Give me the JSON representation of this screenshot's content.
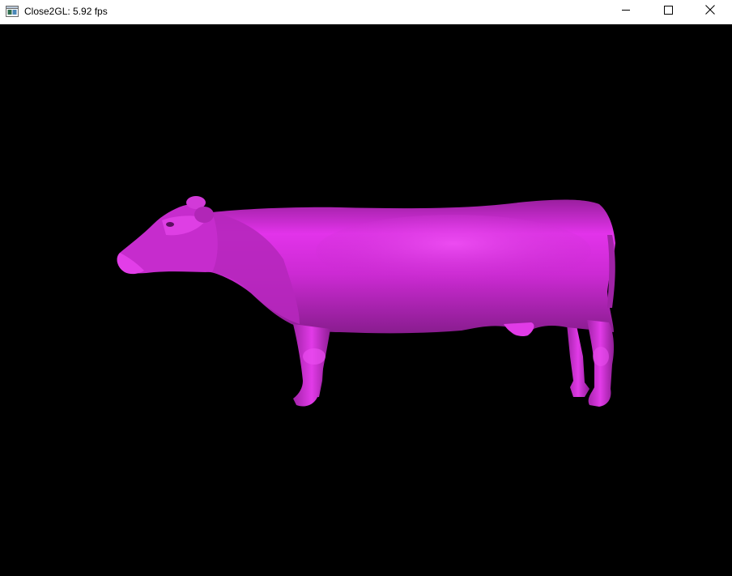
{
  "window": {
    "title": "Close2GL: 5.92 fps",
    "controls": {
      "minimize_icon": "minimize-icon",
      "maximize_icon": "maximize-icon",
      "close_icon": "close-icon"
    }
  },
  "viewport": {
    "background_color": "#000000",
    "model": "cow",
    "model_color": "#e22fe6"
  }
}
